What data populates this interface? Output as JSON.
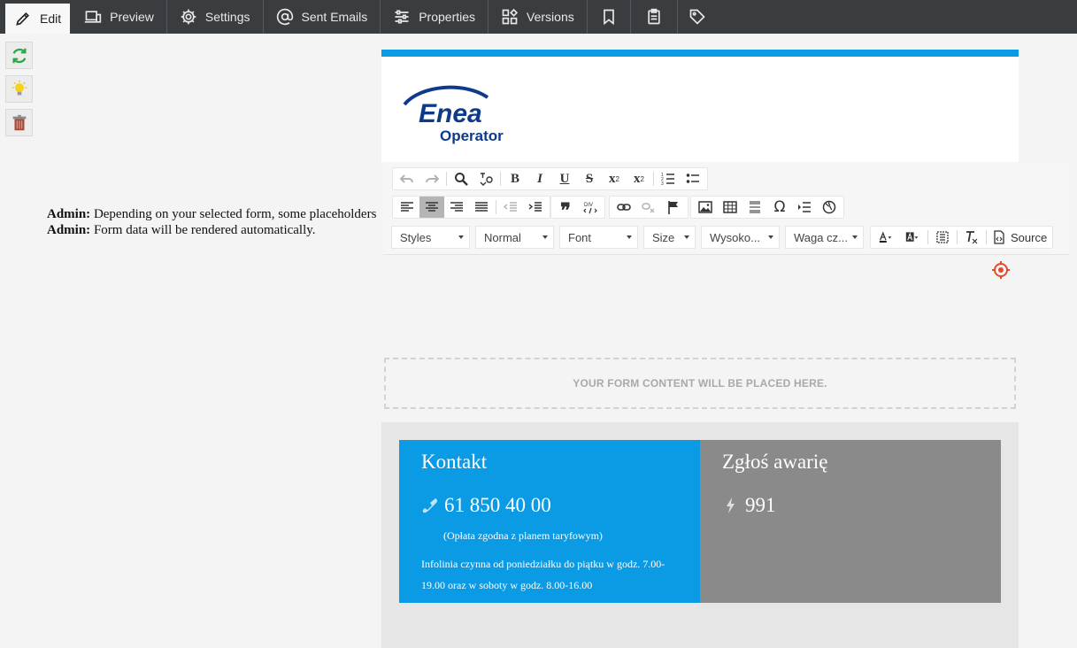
{
  "tabs": [
    {
      "label": "Edit",
      "icon": "pencil-icon",
      "active": true
    },
    {
      "label": "Preview",
      "icon": "devices-icon"
    },
    {
      "label": "Settings",
      "icon": "gear-icon"
    },
    {
      "label": "Sent Emails",
      "icon": "at-sign-icon"
    },
    {
      "label": "Properties",
      "icon": "sliders-icon"
    },
    {
      "label": "Versions",
      "icon": "versions-grid-icon"
    },
    {
      "label": "",
      "icon": "bookmark-icon"
    },
    {
      "label": "",
      "icon": "clipboard-icon"
    },
    {
      "label": "",
      "icon": "tag-icon"
    }
  ],
  "admin_notes": [
    {
      "prefix": "Admin:",
      "text": " Depending on your selected form, some placeholders"
    },
    {
      "prefix": "Admin:",
      "text": " Form data will be rendered automatically."
    }
  ],
  "logo": {
    "line1": "Enea",
    "line2": "Operator",
    "color": "#0e3a8c"
  },
  "toolbar": {
    "combos": [
      "Styles",
      "Normal",
      "Font",
      "Size",
      "Wysoko...",
      "Waga cz..."
    ],
    "source_label": "Source",
    "bold": "B",
    "italic": "I",
    "underline": "U",
    "strike": "S",
    "subscript": "x",
    "sub_mark": "2",
    "superscript": "x",
    "sup_mark": "2",
    "omega": "Ω",
    "quote": "❞"
  },
  "form_placeholder": "YOUR FORM CONTENT WILL BE PLACED HERE.",
  "contact": {
    "title": "Kontakt",
    "phone": "61 850 40 00",
    "note": "(Opłata zgodna z planem taryfowym)",
    "hours": "Infolinia czynna od poniedziałku do piątku w godz. 7.00-19.00 oraz w soboty w godz. 8.00-16.00"
  },
  "failure": {
    "title": "Zgłoś awarię",
    "number": "991"
  },
  "colors": {
    "accent_blue": "#0b9ae4",
    "grey_box": "#8a8a8a",
    "topbar": "#3a3d40",
    "target_red": "#e24b2a"
  }
}
